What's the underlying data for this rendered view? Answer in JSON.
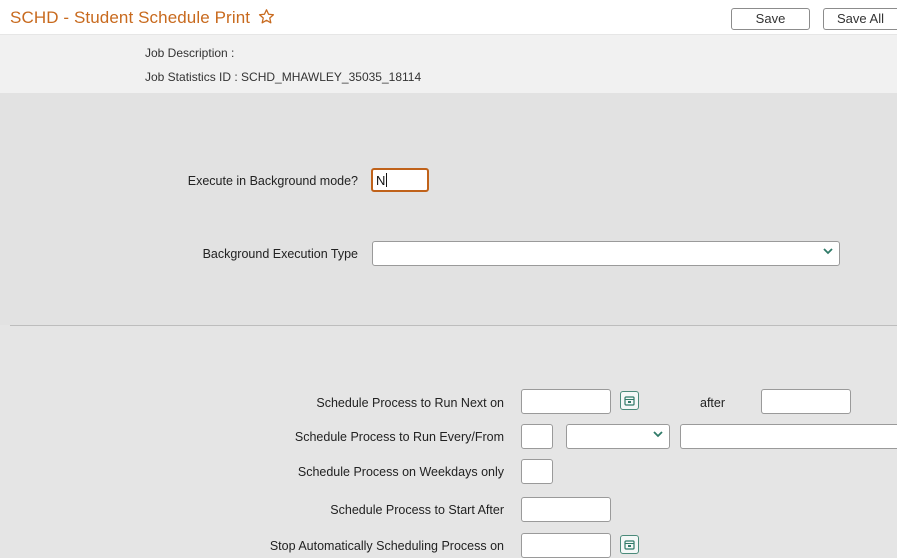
{
  "header": {
    "title": "SCHD - Student Schedule Print",
    "favorite_icon": "star-outline-icon",
    "save_label": "Save",
    "save_all_label": "Save All"
  },
  "job": {
    "description_label": "Job Description :",
    "stats_label": "Job Statistics ID : SCHD_MHAWLEY_35035_18114"
  },
  "background": {
    "execute_label": "Execute in Background mode?",
    "execute_value": "N",
    "type_label": "Background Execution Type",
    "type_value": ""
  },
  "schedule": {
    "run_next_label": "Schedule Process to Run Next on",
    "run_next_value": "",
    "after_label": "after",
    "after_value": "",
    "run_every_label": "Schedule Process to Run Every/From",
    "run_every_count": "",
    "run_every_unit": "",
    "run_every_from": "",
    "weekdays_label": "Schedule Process on Weekdays only",
    "weekdays_value": "",
    "start_after_label": "Schedule Process to Start After",
    "start_after_value": "",
    "stop_label": "Stop Automatically Scheduling Process on",
    "stop_value": ""
  },
  "colors": {
    "accent": "#c86a1e",
    "calendar_border": "#4a8a7a"
  }
}
